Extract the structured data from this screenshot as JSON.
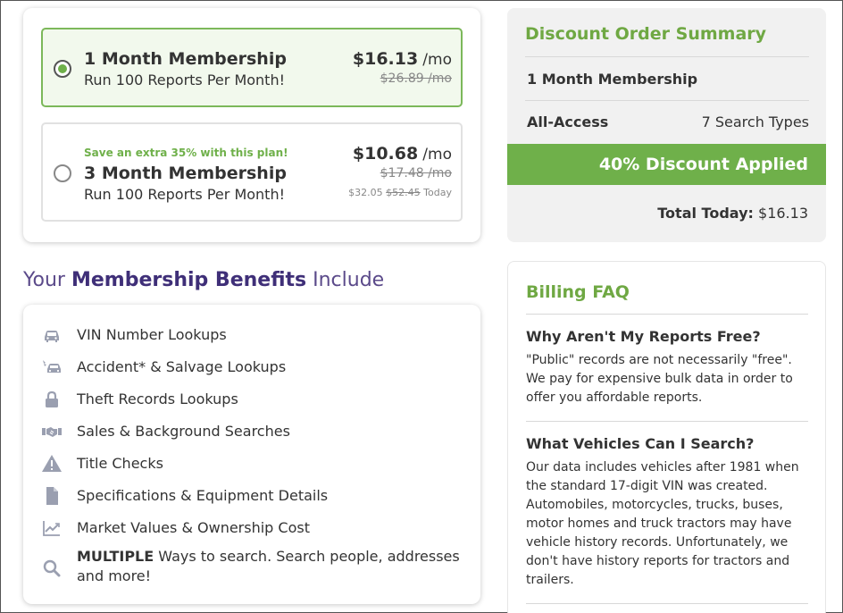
{
  "plans": [
    {
      "title": "1 Month Membership",
      "subtitle": "Run 100 Reports Per Month!",
      "price": "$16.13",
      "per": "/mo",
      "old_price": "$26.89 /mo",
      "selected": true
    },
    {
      "promo": "Save an extra 35% with this plan!",
      "title": "3 Month Membership",
      "subtitle": "Run 100 Reports Per Month!",
      "price": "$10.68",
      "per": "/mo",
      "old_price": "$17.48 /mo",
      "today_price": "$32.05",
      "today_old": "$52.45",
      "today_label": "Today",
      "selected": false
    }
  ],
  "benefits_heading": {
    "pre": "Your ",
    "bold": "Membership Benefits",
    "post": " Include"
  },
  "benefits": [
    {
      "icon": "car-icon",
      "label": "VIN Number Lookups"
    },
    {
      "icon": "crash-icon",
      "label": "Accident* & Salvage Lookups"
    },
    {
      "icon": "lock-icon",
      "label": "Theft Records Lookups"
    },
    {
      "icon": "handshake-icon",
      "label": "Sales & Background Searches"
    },
    {
      "icon": "warning-icon",
      "label": "Title Checks"
    },
    {
      "icon": "document-icon",
      "label": "Specifications & Equipment Details"
    },
    {
      "icon": "chart-icon",
      "label": "Market Values & Ownership Cost"
    },
    {
      "icon": "search-icon",
      "bold": "MULTIPLE",
      "label": " Ways to search. Search people, addresses and more!"
    }
  ],
  "summary": {
    "title": "Discount Order Summary",
    "membership": "1 Month Membership",
    "access_label": "All-Access",
    "access_value": "7 Search Types",
    "discount": "40% Discount Applied",
    "total_label": "Total Today:",
    "total_value": "$16.13"
  },
  "faq": {
    "title": "Billing FAQ",
    "items": [
      {
        "q": "Why Aren't My Reports Free?",
        "a": "\"Public\" records are not necessarily \"free\". We pay for expensive bulk data in order to offer you affordable reports."
      },
      {
        "q": "What Vehicles Can I Search?",
        "a": "Our data includes vehicles after 1981 when the standard 17-digit VIN was created. Automobiles, motorcycles, trucks, buses, motor homes and truck tractors may have vehicle history records. Unfortunately, we don't have history reports for tractors and trailers."
      }
    ]
  },
  "colors": {
    "accent_green": "#6fb04a",
    "heading_green": "#6fa843",
    "purple": "#3f2f78",
    "icon_gray": "#9a9fb0"
  }
}
